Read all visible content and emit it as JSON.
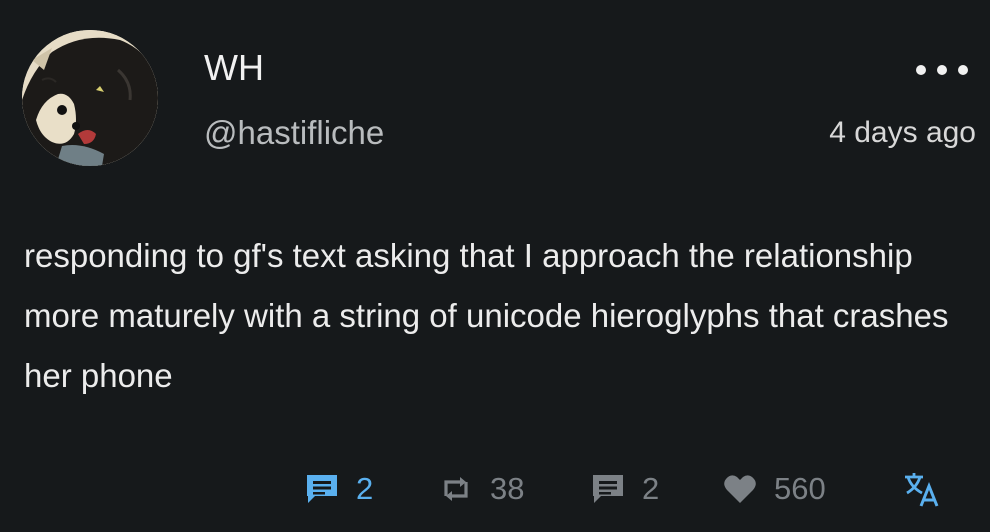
{
  "author": {
    "display_name": "WH",
    "handle": "@hastifliche",
    "avatar": "ukiyo-e-portrait-avatar"
  },
  "post": {
    "timestamp": "4 days ago",
    "text": "responding to gf's text asking that I approach the relationship more maturely with a string of unicode hieroglyphs that crashes her phone"
  },
  "actions": {
    "comments": {
      "icon": "comment-bubble-icon",
      "count": "2",
      "color": "#5ab0ef"
    },
    "boosts": {
      "icon": "repost-icon",
      "count": "38",
      "color": "#7c8186"
    },
    "quotes": {
      "icon": "quote-bubble-icon",
      "count": "2",
      "color": "#7c8186"
    },
    "likes": {
      "icon": "heart-icon",
      "count": "560",
      "color": "#7c8186"
    },
    "translate": {
      "icon": "translate-icon",
      "color": "#5ab0ef"
    }
  },
  "theme": {
    "background": "#16191b",
    "text": "#ececec",
    "muted": "#b9bcbe",
    "accent": "#5ab0ef"
  }
}
